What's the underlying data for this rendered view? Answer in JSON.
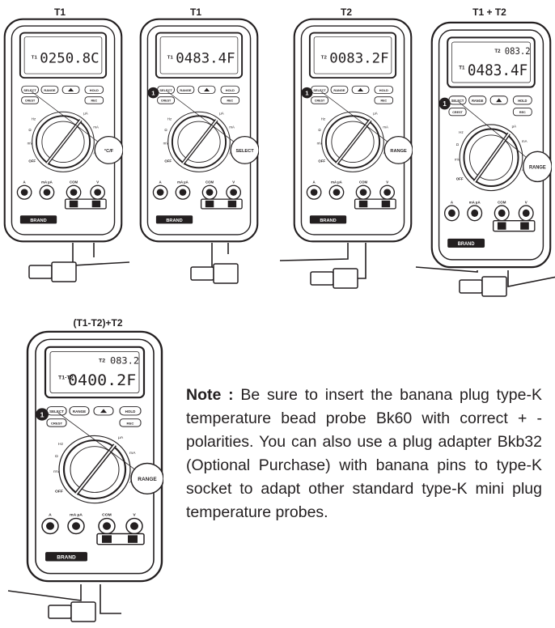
{
  "panels": [
    {
      "caption": "T1",
      "sub_label": "T1",
      "main_value": "0250.8C",
      "top_label": "",
      "top_value": "",
      "button_tag": "°C/F"
    },
    {
      "caption": "T1",
      "sub_label": "T1",
      "main_value": "0483.4F",
      "top_label": "",
      "top_value": "",
      "button_tag": "SELECT"
    },
    {
      "caption": "T2",
      "sub_label": "T2",
      "main_value": "0083.2F",
      "top_label": "",
      "top_value": "",
      "button_tag": "RANGE"
    },
    {
      "caption": "T1 + T2",
      "sub_label": "T1",
      "main_value": "0483.4F",
      "top_label": "T2",
      "top_value": "083.2",
      "button_tag": "RANGE"
    },
    {
      "caption": "(T1-T2)+T2",
      "sub_label": "T1-T2",
      "main_value": "0400.2F",
      "top_label": "T2",
      "top_value": "083.2",
      "button_tag": "RANGE"
    }
  ],
  "step_marker": "1",
  "buttons": {
    "select": "SELECT",
    "range": "RANGE",
    "hold": "HOLD",
    "rec": "REC",
    "crest": "CREST"
  },
  "jacks": {
    "a": "A",
    "ma": "mA µA",
    "com": "COM",
    "v": "V"
  },
  "brand": "BRAND",
  "note": {
    "label": "Note :",
    "text": "Be sure to insert the banana plug type-K temperature bead probe Bk60 with correct + - polarities.  You can also use a plug adapter Bkb32 (Optional Purchase) with banana pins to type-K socket to adapt other standard type-K mini plug temperature probes."
  }
}
